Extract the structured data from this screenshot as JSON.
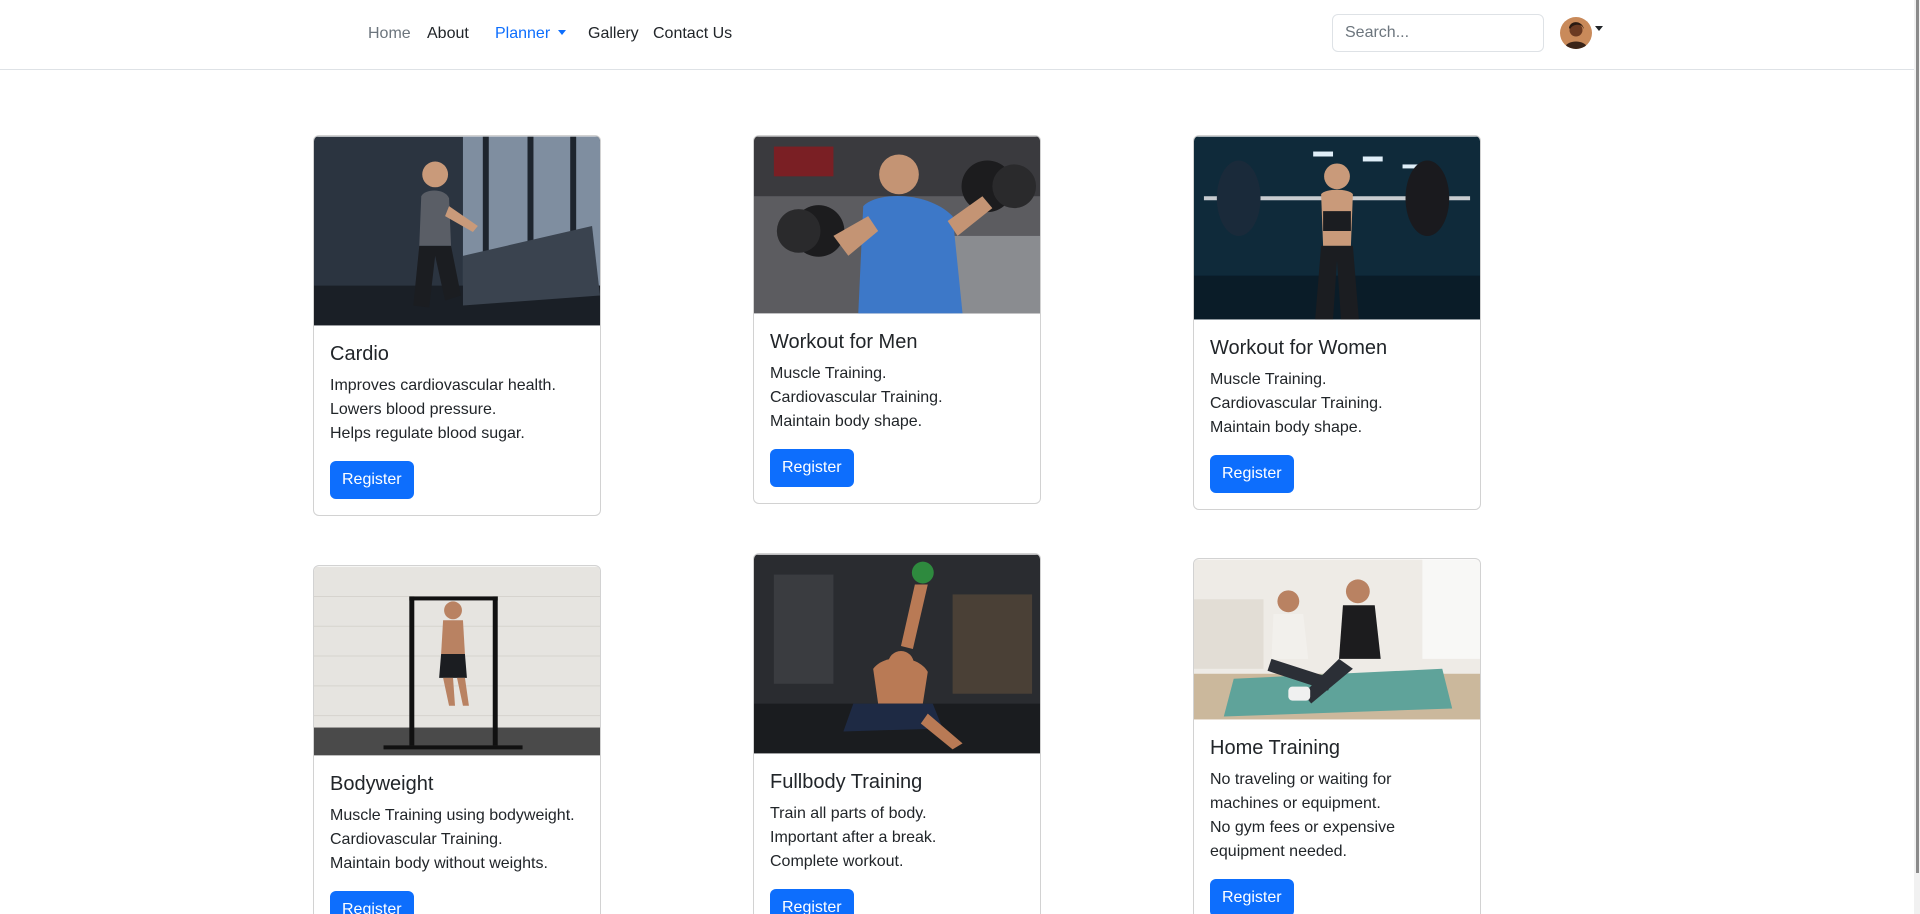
{
  "nav": {
    "home": "Home",
    "about": "About",
    "planner": "Planner",
    "gallery": "Gallery",
    "contact": "Contact Us",
    "search_placeholder": "Search..."
  },
  "colors": {
    "primary": "#0d6efd",
    "muted": "#6c757d",
    "text": "#212529",
    "border": "#dee2e6"
  },
  "cards": [
    {
      "title": "Cardio",
      "lines": [
        "Improves cardiovascular health.",
        "Lowers blood pressure.",
        "Helps regulate blood sugar."
      ],
      "button": "Register"
    },
    {
      "title": "Workout for Men",
      "lines": [
        "Muscle Training.",
        "Cardiovascular Training.",
        "Maintain body shape."
      ],
      "button": "Register"
    },
    {
      "title": "Workout for Women",
      "lines": [
        "Muscle Training.",
        "Cardiovascular Training.",
        "Maintain body shape."
      ],
      "button": "Register"
    },
    {
      "title": "Bodyweight",
      "lines": [
        "Muscle Training using bodyweight.",
        "Cardiovascular Training.",
        "Maintain body without weights."
      ],
      "button": "Register"
    },
    {
      "title": "Fullbody Training",
      "lines": [
        "Train all parts of body.",
        "Important after a break.",
        "Complete workout."
      ],
      "button": "Register"
    },
    {
      "title": "Home Training",
      "lines": [
        "No traveling or waiting for",
        "machines or equipment.",
        "No gym fees or expensive",
        "equipment needed."
      ],
      "button": "Register"
    }
  ]
}
